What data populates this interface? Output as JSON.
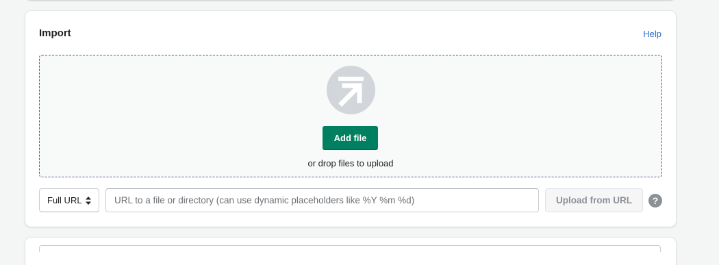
{
  "import_card": {
    "title": "Import",
    "help_link": "Help"
  },
  "dropzone": {
    "icon": "upload-arrow-icon",
    "add_file_label": "Add file",
    "hint": "or drop files to upload"
  },
  "url_upload": {
    "mode_selected": "Full URL",
    "input_placeholder": "URL to a file or directory (can use dynamic placeholders like %Y %m %d)",
    "input_value": "",
    "upload_button_label": "Upload from URL",
    "help_icon": "?"
  },
  "colors": {
    "primary": "#008060",
    "link": "#2c6ecb",
    "dropzone_border": "#4a5b8c"
  }
}
